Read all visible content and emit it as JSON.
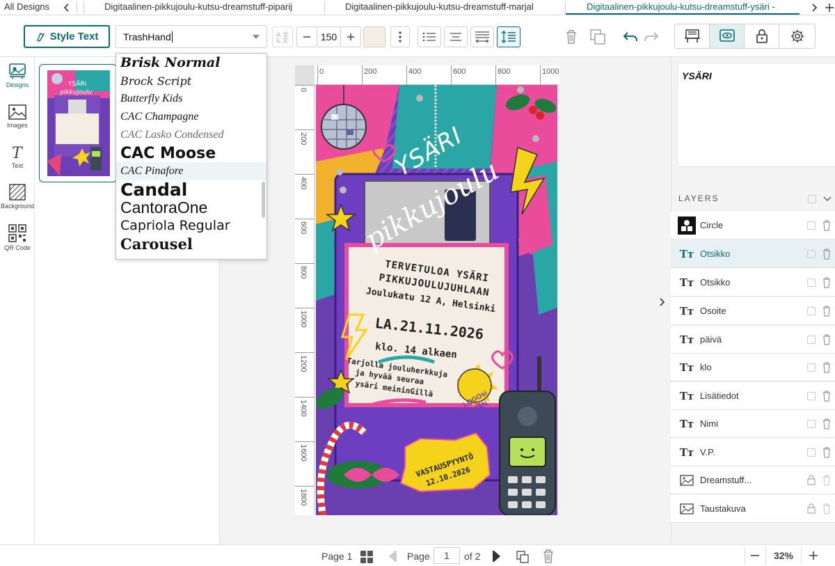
{
  "tabs": {
    "all_designs": "All Designs",
    "items": [
      "Digitaalinen-pikkujoulu-kutsu-dreamstuff-piparij",
      "Digitaalinen-pikkujoulu-kutsu-dreamstuff-marjal",
      "Digitaalinen-pikkujoulu-kutsu-dreamstuff-ysäri -"
    ]
  },
  "toolbar": {
    "style_text": "Style Text",
    "font_value": "TrashHand",
    "font_size": "150"
  },
  "font_list": [
    "Brisk Normal",
    "Brock Script",
    "Butterfly Kids",
    "CAC Champagne",
    "CAC Lasko Condensed",
    "CAC Moose",
    "CAC Pinafore",
    "Candal",
    "CantoraOne",
    "Capriola Regular",
    "Carousel"
  ],
  "rail": {
    "designs": "Designs",
    "images": "Images",
    "text": "Text",
    "background": "Background",
    "qr": "QR Code"
  },
  "ruler": {
    "h": [
      "0",
      "200",
      "400",
      "600",
      "800",
      "1000"
    ],
    "v": [
      "0",
      "200",
      "400",
      "600",
      "800",
      "1000",
      "1200",
      "1400",
      "1600",
      "1800"
    ]
  },
  "invite": {
    "ysari": "YSÄRI",
    "pikkujoulu": "pikkujoulu",
    "line1": "TERVETULOA YSÄRI",
    "line2": "PIKKUJOULUJUHLAAN",
    "line3": "Joulukatu 12 A, Helsinki",
    "date": "LA.21.11.2026",
    "time": "klo. 14 alkaen",
    "extra1": "Tarjolla jouluherkkuja",
    "extra2": "ja hyvää seuraa",
    "extra3": "ysäri meininGillä",
    "logo1": "LOGOsi",
    "logo2": "TÄHÄN",
    "rsvp1": "VASTAUSPYYNTÖ",
    "rsvp2": "12.10.2026"
  },
  "text_preview": "YSÄRI",
  "layers_title": "LAYERS",
  "layers": [
    {
      "name": "Circle",
      "kind": "shape"
    },
    {
      "name": "Otsikko",
      "kind": "text"
    },
    {
      "name": "Otsikko",
      "kind": "text"
    },
    {
      "name": "Osoite",
      "kind": "text"
    },
    {
      "name": "päivä",
      "kind": "text"
    },
    {
      "name": "klo",
      "kind": "text"
    },
    {
      "name": "Lisätiedot",
      "kind": "text"
    },
    {
      "name": "Nimi",
      "kind": "text"
    },
    {
      "name": "V.P.",
      "kind": "text"
    },
    {
      "name": "Dreamstuff...",
      "kind": "image"
    },
    {
      "name": "Taustakuva",
      "kind": "image"
    }
  ],
  "bottom": {
    "page_label": "Page 1",
    "page_word": "Page",
    "page_input": "1",
    "page_of": "of 2",
    "zoom": "32%"
  },
  "colors": {
    "accent": "#0b6b73",
    "pink": "#ef3f8f",
    "purple": "#6a3fb0",
    "yellow": "#f5d31c",
    "teal": "#2aa6a6"
  }
}
